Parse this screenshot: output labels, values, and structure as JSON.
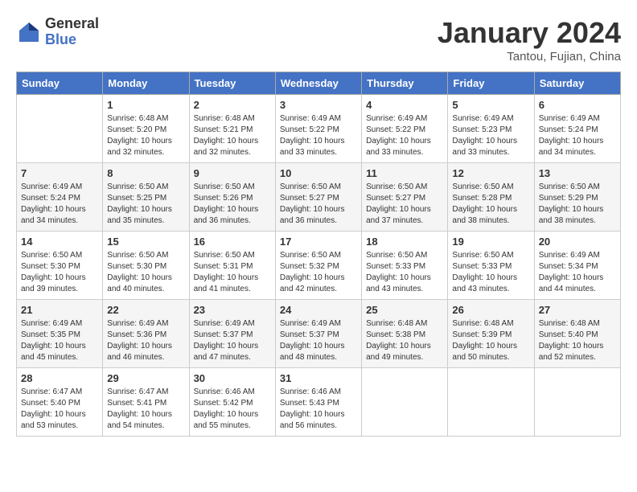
{
  "logo": {
    "general": "General",
    "blue": "Blue"
  },
  "title": "January 2024",
  "subtitle": "Tantou, Fujian, China",
  "weekdays": [
    "Sunday",
    "Monday",
    "Tuesday",
    "Wednesday",
    "Thursday",
    "Friday",
    "Saturday"
  ],
  "weeks": [
    [
      {
        "day": "",
        "sunrise": "",
        "sunset": "",
        "daylight": ""
      },
      {
        "day": "1",
        "sunrise": "Sunrise: 6:48 AM",
        "sunset": "Sunset: 5:20 PM",
        "daylight": "Daylight: 10 hours and 32 minutes."
      },
      {
        "day": "2",
        "sunrise": "Sunrise: 6:48 AM",
        "sunset": "Sunset: 5:21 PM",
        "daylight": "Daylight: 10 hours and 32 minutes."
      },
      {
        "day": "3",
        "sunrise": "Sunrise: 6:49 AM",
        "sunset": "Sunset: 5:22 PM",
        "daylight": "Daylight: 10 hours and 33 minutes."
      },
      {
        "day": "4",
        "sunrise": "Sunrise: 6:49 AM",
        "sunset": "Sunset: 5:22 PM",
        "daylight": "Daylight: 10 hours and 33 minutes."
      },
      {
        "day": "5",
        "sunrise": "Sunrise: 6:49 AM",
        "sunset": "Sunset: 5:23 PM",
        "daylight": "Daylight: 10 hours and 33 minutes."
      },
      {
        "day": "6",
        "sunrise": "Sunrise: 6:49 AM",
        "sunset": "Sunset: 5:24 PM",
        "daylight": "Daylight: 10 hours and 34 minutes."
      }
    ],
    [
      {
        "day": "7",
        "sunrise": "Sunrise: 6:49 AM",
        "sunset": "Sunset: 5:24 PM",
        "daylight": "Daylight: 10 hours and 34 minutes."
      },
      {
        "day": "8",
        "sunrise": "Sunrise: 6:50 AM",
        "sunset": "Sunset: 5:25 PM",
        "daylight": "Daylight: 10 hours and 35 minutes."
      },
      {
        "day": "9",
        "sunrise": "Sunrise: 6:50 AM",
        "sunset": "Sunset: 5:26 PM",
        "daylight": "Daylight: 10 hours and 36 minutes."
      },
      {
        "day": "10",
        "sunrise": "Sunrise: 6:50 AM",
        "sunset": "Sunset: 5:27 PM",
        "daylight": "Daylight: 10 hours and 36 minutes."
      },
      {
        "day": "11",
        "sunrise": "Sunrise: 6:50 AM",
        "sunset": "Sunset: 5:27 PM",
        "daylight": "Daylight: 10 hours and 37 minutes."
      },
      {
        "day": "12",
        "sunrise": "Sunrise: 6:50 AM",
        "sunset": "Sunset: 5:28 PM",
        "daylight": "Daylight: 10 hours and 38 minutes."
      },
      {
        "day": "13",
        "sunrise": "Sunrise: 6:50 AM",
        "sunset": "Sunset: 5:29 PM",
        "daylight": "Daylight: 10 hours and 38 minutes."
      }
    ],
    [
      {
        "day": "14",
        "sunrise": "Sunrise: 6:50 AM",
        "sunset": "Sunset: 5:30 PM",
        "daylight": "Daylight: 10 hours and 39 minutes."
      },
      {
        "day": "15",
        "sunrise": "Sunrise: 6:50 AM",
        "sunset": "Sunset: 5:30 PM",
        "daylight": "Daylight: 10 hours and 40 minutes."
      },
      {
        "day": "16",
        "sunrise": "Sunrise: 6:50 AM",
        "sunset": "Sunset: 5:31 PM",
        "daylight": "Daylight: 10 hours and 41 minutes."
      },
      {
        "day": "17",
        "sunrise": "Sunrise: 6:50 AM",
        "sunset": "Sunset: 5:32 PM",
        "daylight": "Daylight: 10 hours and 42 minutes."
      },
      {
        "day": "18",
        "sunrise": "Sunrise: 6:50 AM",
        "sunset": "Sunset: 5:33 PM",
        "daylight": "Daylight: 10 hours and 43 minutes."
      },
      {
        "day": "19",
        "sunrise": "Sunrise: 6:50 AM",
        "sunset": "Sunset: 5:33 PM",
        "daylight": "Daylight: 10 hours and 43 minutes."
      },
      {
        "day": "20",
        "sunrise": "Sunrise: 6:49 AM",
        "sunset": "Sunset: 5:34 PM",
        "daylight": "Daylight: 10 hours and 44 minutes."
      }
    ],
    [
      {
        "day": "21",
        "sunrise": "Sunrise: 6:49 AM",
        "sunset": "Sunset: 5:35 PM",
        "daylight": "Daylight: 10 hours and 45 minutes."
      },
      {
        "day": "22",
        "sunrise": "Sunrise: 6:49 AM",
        "sunset": "Sunset: 5:36 PM",
        "daylight": "Daylight: 10 hours and 46 minutes."
      },
      {
        "day": "23",
        "sunrise": "Sunrise: 6:49 AM",
        "sunset": "Sunset: 5:37 PM",
        "daylight": "Daylight: 10 hours and 47 minutes."
      },
      {
        "day": "24",
        "sunrise": "Sunrise: 6:49 AM",
        "sunset": "Sunset: 5:37 PM",
        "daylight": "Daylight: 10 hours and 48 minutes."
      },
      {
        "day": "25",
        "sunrise": "Sunrise: 6:48 AM",
        "sunset": "Sunset: 5:38 PM",
        "daylight": "Daylight: 10 hours and 49 minutes."
      },
      {
        "day": "26",
        "sunrise": "Sunrise: 6:48 AM",
        "sunset": "Sunset: 5:39 PM",
        "daylight": "Daylight: 10 hours and 50 minutes."
      },
      {
        "day": "27",
        "sunrise": "Sunrise: 6:48 AM",
        "sunset": "Sunset: 5:40 PM",
        "daylight": "Daylight: 10 hours and 52 minutes."
      }
    ],
    [
      {
        "day": "28",
        "sunrise": "Sunrise: 6:47 AM",
        "sunset": "Sunset: 5:40 PM",
        "daylight": "Daylight: 10 hours and 53 minutes."
      },
      {
        "day": "29",
        "sunrise": "Sunrise: 6:47 AM",
        "sunset": "Sunset: 5:41 PM",
        "daylight": "Daylight: 10 hours and 54 minutes."
      },
      {
        "day": "30",
        "sunrise": "Sunrise: 6:46 AM",
        "sunset": "Sunset: 5:42 PM",
        "daylight": "Daylight: 10 hours and 55 minutes."
      },
      {
        "day": "31",
        "sunrise": "Sunrise: 6:46 AM",
        "sunset": "Sunset: 5:43 PM",
        "daylight": "Daylight: 10 hours and 56 minutes."
      },
      {
        "day": "",
        "sunrise": "",
        "sunset": "",
        "daylight": ""
      },
      {
        "day": "",
        "sunrise": "",
        "sunset": "",
        "daylight": ""
      },
      {
        "day": "",
        "sunrise": "",
        "sunset": "",
        "daylight": ""
      }
    ]
  ]
}
